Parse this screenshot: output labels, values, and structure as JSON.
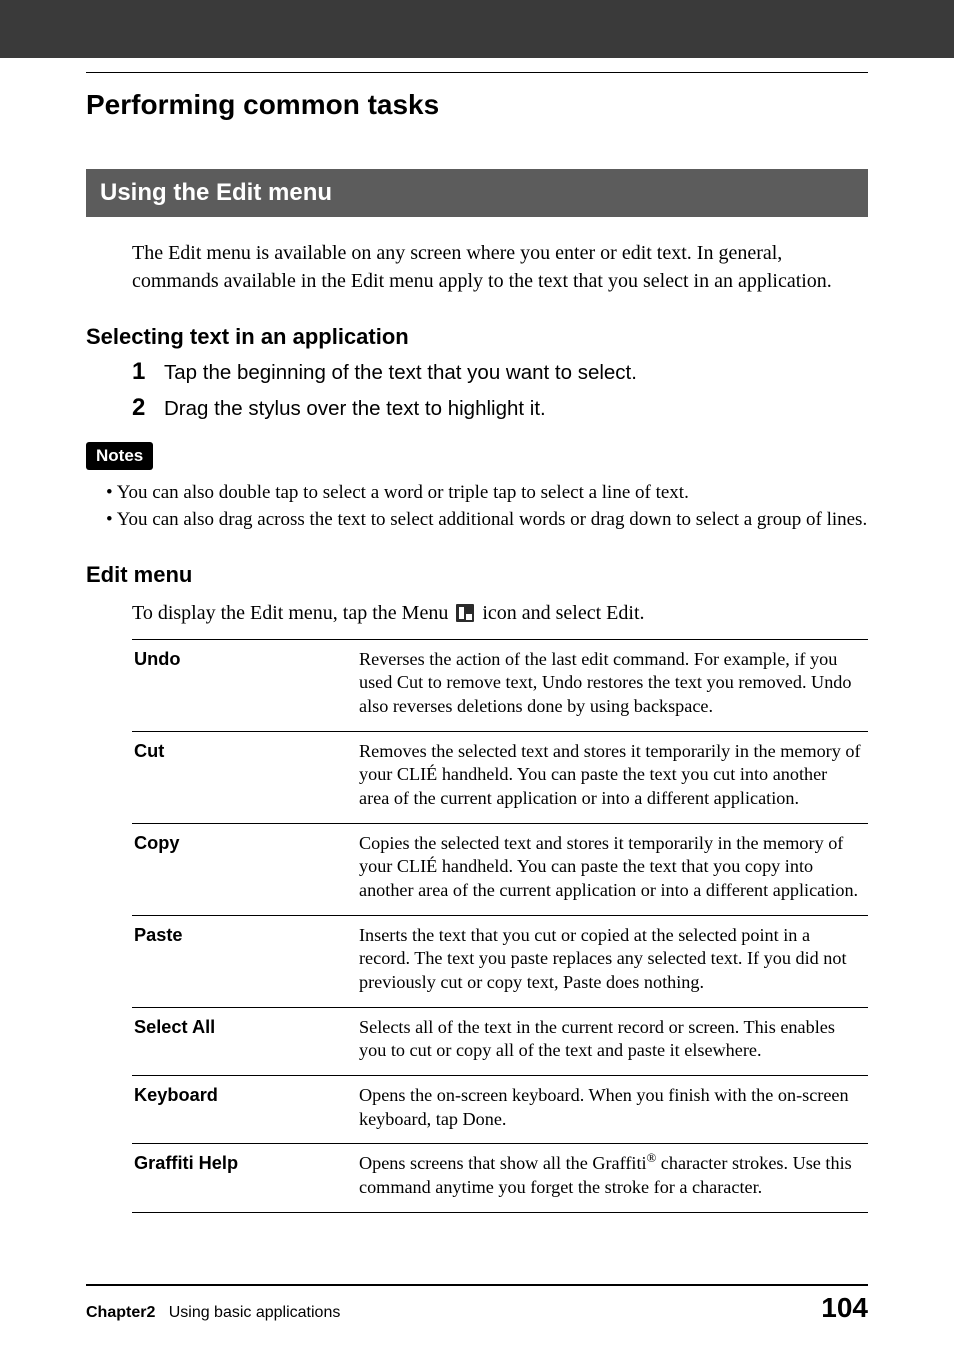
{
  "header_title": "Performing common tasks",
  "section_band": "Using the Edit menu",
  "intro": "The Edit menu is available on any screen where you enter or edit text. In general, commands available in the Edit menu apply to the text that you select in an application.",
  "selecting_heading": "Selecting text in an application",
  "steps": {
    "s1_num": "1",
    "s1_text": "Tap the beginning of the text that you want to select.",
    "s2_num": "2",
    "s2_text": "Drag the stylus over the text to highlight it."
  },
  "notes_label": "Notes",
  "notes": {
    "n1": "You can also double tap to select a word or triple tap to select a line of text.",
    "n2": "You can also drag across the text to select additional words or drag down to select a group of lines."
  },
  "editmenu_heading": "Edit menu",
  "display_pre": "To display the Edit menu, tap the Menu",
  "display_post": "icon and select Edit.",
  "table": {
    "undo": {
      "term": "Undo",
      "desc": "Reverses the action of the last edit command. For example, if you used Cut to remove text, Undo restores the text you removed. Undo also reverses deletions done by using backspace."
    },
    "cut": {
      "term": "Cut",
      "desc": "Removes the selected text and stores it temporarily in the memory of your CLIÉ handheld. You can paste the text you cut into another area of the current application or into a different application."
    },
    "copy": {
      "term": "Copy",
      "desc": "Copies the selected text and stores it temporarily in the memory of your CLIÉ handheld. You can paste the text that you copy into another area of the current application or into a different application."
    },
    "paste": {
      "term": "Paste",
      "desc": "Inserts the text that you cut or copied at the selected point in a record. The text you paste replaces any selected text. If you did not previously cut or copy text, Paste does nothing."
    },
    "selectall": {
      "term": "Select All",
      "desc": "Selects all of the text in the current record or screen. This enables you to cut or copy all of the text and paste it elsewhere."
    },
    "keyboard": {
      "term": "Keyboard",
      "desc": "Opens the on-screen keyboard. When you finish with the on-screen keyboard, tap Done."
    },
    "graffiti": {
      "term": "Graffiti Help",
      "desc_pre": "Opens screens that show all the Graffiti",
      "desc_post": " character strokes. Use this command anytime you forget the stroke for a character."
    }
  },
  "footer": {
    "chapter_label": "Chapter2",
    "chapter_title": "Using basic applications",
    "page": "104"
  },
  "reg_symbol": "®"
}
